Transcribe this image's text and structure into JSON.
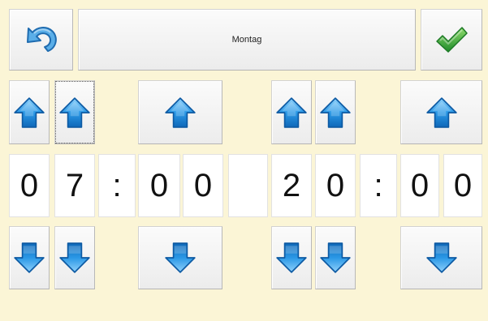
{
  "header": {
    "day_label": "Montag"
  },
  "icons": {
    "back": "undo-arrow-icon",
    "confirm": "checkmark-icon",
    "up": "arrow-up-icon",
    "down": "arrow-down-icon"
  },
  "colors": {
    "arrow_blue": "#1e8fe0",
    "check_green": "#2fa33a",
    "background": "#fbf5d6"
  },
  "time_start": {
    "hour_tens": "0",
    "hour_ones": "7",
    "separator": ":",
    "minute_tens": "0",
    "minute_ones": "0"
  },
  "time_end": {
    "hour_tens": "2",
    "hour_ones": "0",
    "separator": ":",
    "minute_tens": "0",
    "minute_ones": "0"
  }
}
